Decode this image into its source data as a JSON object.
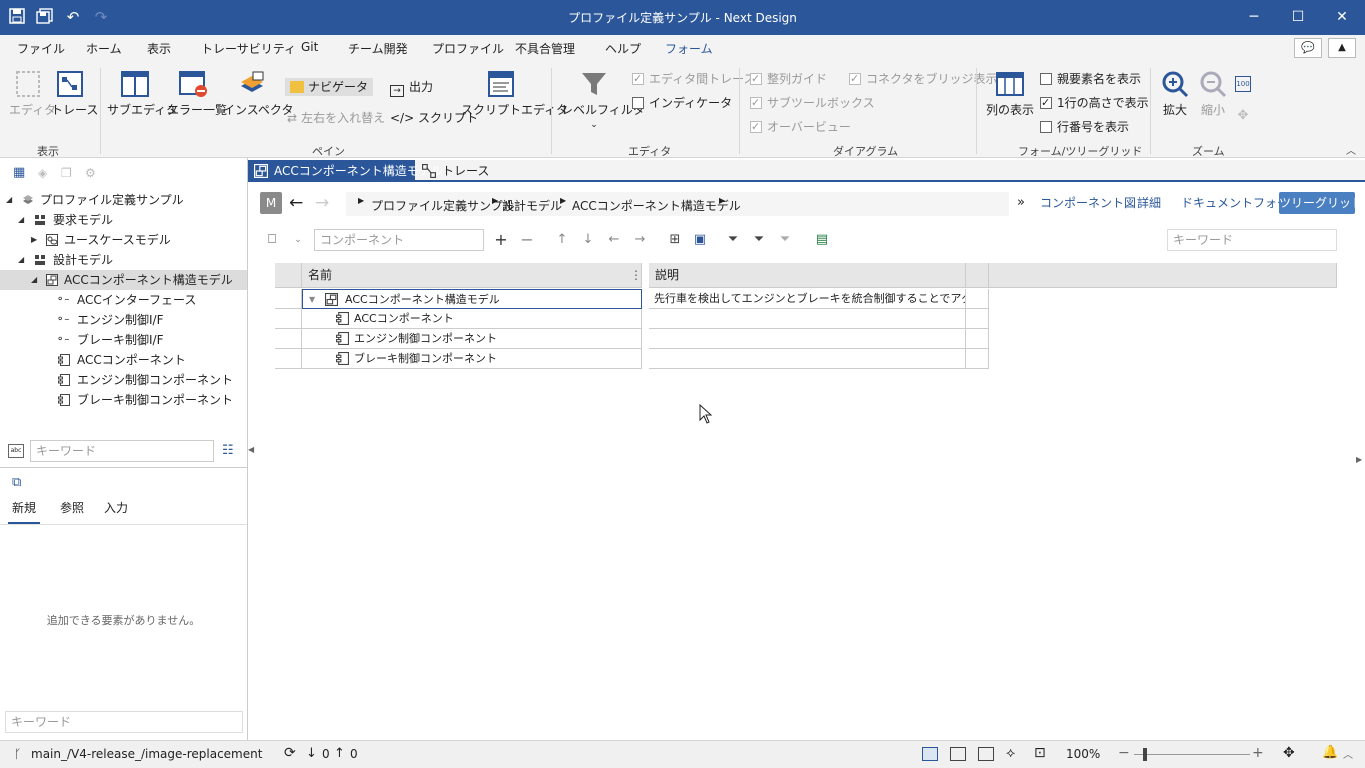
{
  "window": {
    "title": "プロファイル定義サンプル - Next Design"
  },
  "menu": [
    "ファイル",
    "ホーム",
    "表示",
    "トレーサビリティ",
    "Git",
    "チーム開発",
    "プロファイル",
    "不具合管理",
    "ヘルプ",
    "フォーム"
  ],
  "ribbon": {
    "show_group": {
      "label": "表示",
      "editor": "エディタ",
      "trace": "トレース"
    },
    "pane_group": {
      "label": "ペイン",
      "subeditor": "サブエディタ",
      "errorlist": "エラー一覧",
      "inspector": "インスペクタ",
      "navigator": "ナビゲータ",
      "swap": "左右を入れ替え",
      "output": "出力",
      "script": "</> スクリプト",
      "scripteditor": "スクリプトエディタ"
    },
    "editor_group": {
      "label": "エディタ",
      "levelfilter": "レベルフィルタ",
      "trace_between": "エディタ間トレース",
      "indicator": "インディケータ"
    },
    "diagram_group": {
      "label": "ダイアグラム",
      "align_guide": "整列ガイド",
      "sub_toolbox": "サブツールボックス",
      "overview": "オーバービュー",
      "bridge": "コネクタをブリッジ表示"
    },
    "form_group": {
      "label": "フォーム/ツリーグリッド",
      "columns": "列の表示",
      "parent_name": "親要素名を表示",
      "row_height": "1行の高さで表示",
      "row_number": "行番号を表示"
    },
    "zoom_group": {
      "label": "ズーム",
      "zoom_in": "拡大",
      "zoom_out": "縮小"
    }
  },
  "tree": {
    "root": "プロファイル定義サンプル",
    "items": [
      {
        "label": "要求モデル"
      },
      {
        "label": "ユースケースモデル"
      },
      {
        "label": "設計モデル"
      },
      {
        "label": "ACCコンポーネント構造モデル"
      },
      {
        "label": "ACCインターフェース"
      },
      {
        "label": "エンジン制御I/F"
      },
      {
        "label": "ブレーキ制御I/F"
      },
      {
        "label": "ACCコンポーネント"
      },
      {
        "label": "エンジン制御コンポーネント"
      },
      {
        "label": "ブレーキ制御コンポーネント"
      }
    ],
    "search_placeholder": "キーワード"
  },
  "toolbox": {
    "tabs": [
      "新規",
      "参照",
      "入力"
    ],
    "empty_message": "追加できる要素がありません。",
    "search_placeholder": "キーワード"
  },
  "doc_tabs": [
    "ACCコンポーネント構造モデル",
    "トレース"
  ],
  "breadcrumb": {
    "badge": "M",
    "items": [
      "プロファイル定義サンプル",
      "設計モデル",
      "ACCコンポーネント構造モデル"
    ],
    "views": [
      "コンポーネント図",
      "詳細",
      "ドキュメントフォーム",
      "ツリーグリッド"
    ]
  },
  "grid_toolbar": {
    "type_placeholder": "コンポーネント",
    "keyword_placeholder": "キーワード"
  },
  "grid": {
    "headers": [
      "名前",
      "説明"
    ],
    "rows": [
      {
        "name": "ACCコンポーネント構造モデル",
        "desc": "先行車を検出してエンジンとブレーキを統合制御することでアダプティブ･･･"
      },
      {
        "name": "ACCコンポーネント",
        "desc": ""
      },
      {
        "name": "エンジン制御コンポーネント",
        "desc": ""
      },
      {
        "name": "ブレーキ制御コンポーネント",
        "desc": ""
      }
    ]
  },
  "status": {
    "branch": "main_/V4-release_/image-replacement",
    "down": "0",
    "up": "0",
    "zoom": "100%"
  }
}
